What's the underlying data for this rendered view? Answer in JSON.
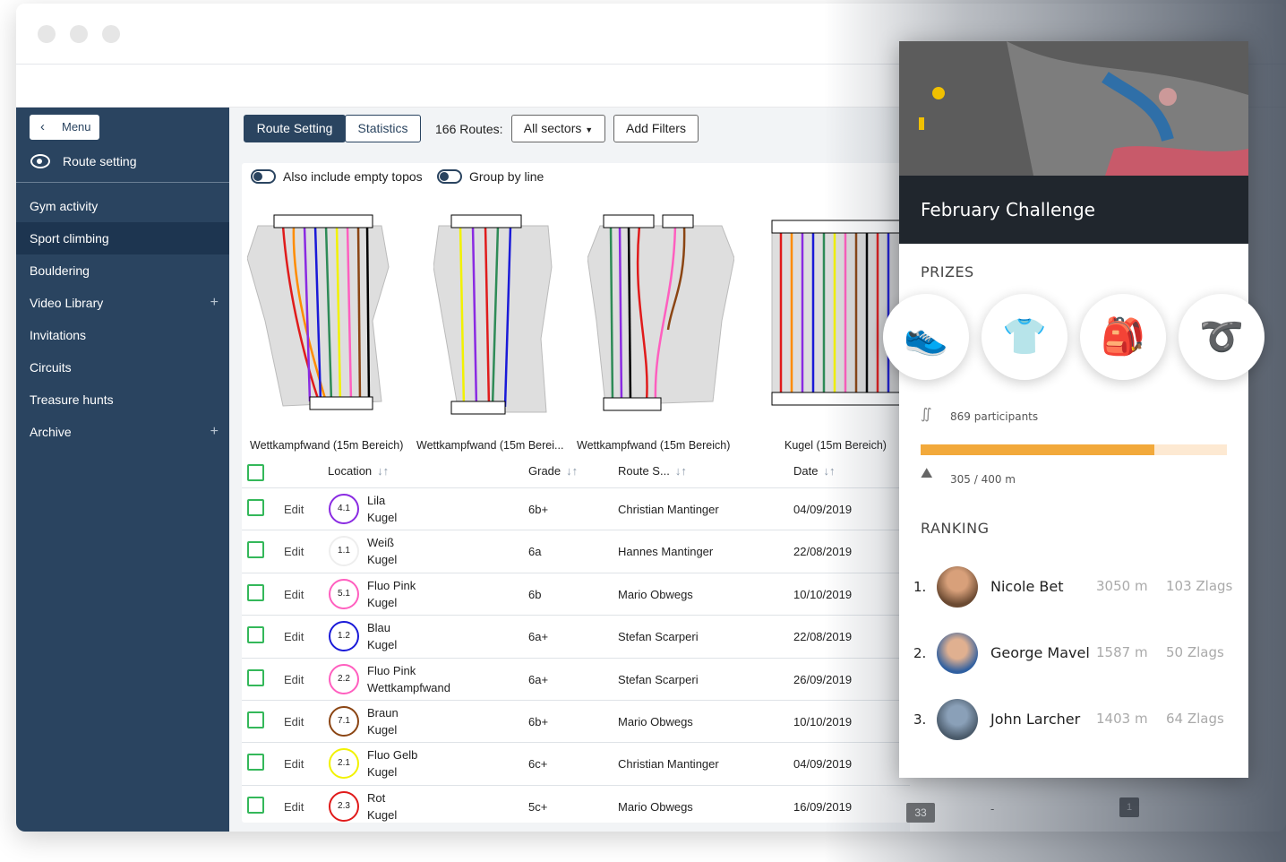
{
  "sidebar": {
    "menu_label": "Menu",
    "section_title": "Route setting",
    "items": [
      {
        "label": "Gym activity"
      },
      {
        "label": "Sport climbing"
      },
      {
        "label": "Bouldering"
      },
      {
        "label": "Video Library",
        "plus": "+"
      },
      {
        "label": "Invitations"
      },
      {
        "label": "Circuits"
      },
      {
        "label": "Treasure hunts"
      },
      {
        "label": "Archive",
        "plus": "+"
      }
    ]
  },
  "toolbar": {
    "tab_route_setting": "Route Setting",
    "tab_statistics": "Statistics",
    "routes_count": "166 Routes:",
    "sector_select": "All sectors",
    "add_filters": "Add Filters"
  },
  "options": {
    "include_empty": "Also include empty topos",
    "group_by_line": "Group by line"
  },
  "topos": [
    {
      "label": "Wettkampfwand (15m Bereich)"
    },
    {
      "label": "Wettkampfwand (15m Berei..."
    },
    {
      "label": "Wettkampfwand (15m Bereich)"
    },
    {
      "label": "Kugel (15m Bereich)"
    }
  ],
  "table": {
    "headers": {
      "location": "Location",
      "grade": "Grade",
      "setter": "Route S...",
      "date": "Date"
    },
    "edit_label": "Edit",
    "rows": [
      {
        "num": "4.1",
        "color": "#8a2be2",
        "name": "Lila",
        "loc": "Kugel",
        "grade": "6b+",
        "setter": "Christian Mantinger",
        "date": "04/09/2019"
      },
      {
        "num": "1.1",
        "color": "#eeeeee",
        "name": "Weiß",
        "loc": "Kugel",
        "grade": "6a",
        "setter": "Hannes Mantinger",
        "date": "22/08/2019"
      },
      {
        "num": "5.1",
        "color": "#ff5fbf",
        "name": "Fluo Pink",
        "loc": "Kugel",
        "grade": "6b",
        "setter": "Mario Obwegs",
        "date": "10/10/2019"
      },
      {
        "num": "1.2",
        "color": "#1a1ad8",
        "name": "Blau",
        "loc": "Kugel",
        "grade": "6a+",
        "setter": "Stefan Scarperi",
        "date": "22/08/2019"
      },
      {
        "num": "2.2",
        "color": "#ff5fbf",
        "name": "Fluo Pink",
        "loc": "Wettkampfwand",
        "grade": "6a+",
        "setter": "Stefan Scarperi",
        "date": "26/09/2019"
      },
      {
        "num": "7.1",
        "color": "#8b4513",
        "name": "Braun",
        "loc": "Kugel",
        "grade": "6b+",
        "setter": "Mario Obwegs",
        "date": "10/10/2019"
      },
      {
        "num": "2.1",
        "color": "#f2f200",
        "name": "Fluo Gelb",
        "loc": "Kugel",
        "grade": "6c+",
        "setter": "Christian Mantinger",
        "date": "04/09/2019"
      },
      {
        "num": "2.3",
        "color": "#e01b1b",
        "name": "Rot",
        "loc": "Kugel",
        "grade": "5c+",
        "setter": "Mario Obwegs",
        "date": "16/09/2019"
      }
    ]
  },
  "trailing": {
    "badge": "33",
    "dash": "-",
    "page": "1"
  },
  "challenge": {
    "title": "February Challenge",
    "prizes_heading": "PRIZES",
    "participants": "869 participants",
    "progress_text": "305 / 400 m",
    "progress": 0.7625,
    "ranking_heading": "RANKING",
    "ranking": [
      {
        "pos": "1.",
        "name": "Nicole Bet",
        "meters": "3050 m",
        "zlags": "103 Zlags"
      },
      {
        "pos": "2.",
        "name": "George Mavel",
        "meters": "1587 m",
        "zlags": "50 Zlags"
      },
      {
        "pos": "3.",
        "name": "John Larcher",
        "meters": "1403 m",
        "zlags": "64 Zlags"
      }
    ]
  },
  "colors": {
    "sidebar": "#2a4460",
    "accent": "#34b85a",
    "progress": "#f2a93b"
  }
}
